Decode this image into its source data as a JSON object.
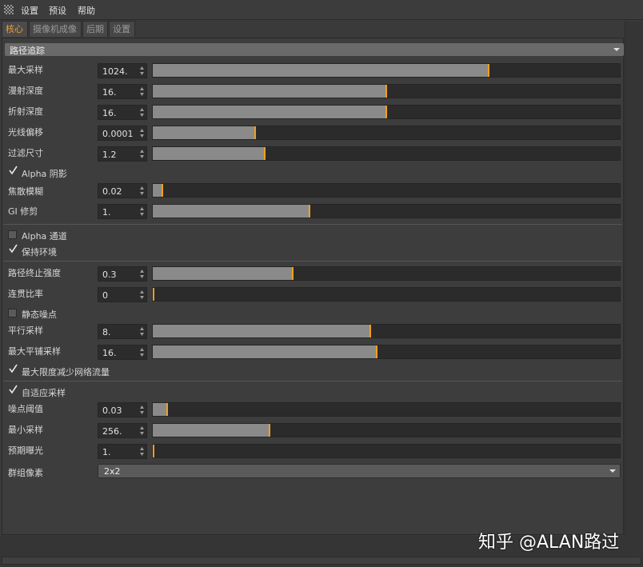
{
  "menubar": {
    "items": [
      "设置",
      "预设",
      "帮助"
    ]
  },
  "tabs": [
    "核心",
    "摄像机成像",
    "后期",
    "设置"
  ],
  "section": {
    "label": "路径追踪"
  },
  "params": {
    "max_samples": {
      "label": "最大采样",
      "value": "1024.",
      "level": 0.72
    },
    "diffuse_depth": {
      "label": "漫射深度",
      "value": "16.",
      "level": 0.5
    },
    "refraction_depth": {
      "label": "折射深度",
      "value": "16.",
      "level": 0.5
    },
    "ray_offset": {
      "label": "光线偏移",
      "value": "0.0001",
      "level": 0.22
    },
    "filter_size": {
      "label": "过滤尺寸",
      "value": "1.2",
      "level": 0.24
    },
    "alpha_shadow": {
      "label": "Alpha 阴影",
      "checked": true
    },
    "caustic_blur": {
      "label": "焦散模糊",
      "value": "0.02",
      "level": 0.02
    },
    "gi_clamp": {
      "label": "GI 修剪",
      "value": "1.",
      "level": 0.335
    },
    "alpha_channel": {
      "label": "Alpha 通道",
      "checked": false
    },
    "keep_environment": {
      "label": "保持环境",
      "checked": true
    },
    "path_termination": {
      "label": "路径终止强度",
      "value": "0.3",
      "level": 0.3
    },
    "coherent_ratio": {
      "label": "连贯比率",
      "value": "0",
      "level": 0.0
    },
    "static_noise": {
      "label": "静态噪点",
      "checked": false
    },
    "parallel_samples": {
      "label": "平行采样",
      "value": "8.",
      "level": 0.465
    },
    "max_tile_samples": {
      "label": "最大平铺采样",
      "value": "16.",
      "level": 0.48
    },
    "minimize_net_traffic": {
      "label": "最大限度减少网络流量",
      "checked": true
    },
    "adaptive_sampling": {
      "label": "自适应采样",
      "checked": true
    },
    "noise_threshold": {
      "label": "噪点阈值",
      "value": "0.03",
      "level": 0.03
    },
    "min_samples": {
      "label": "最小采样",
      "value": "256.",
      "level": 0.25
    },
    "expected_exposure": {
      "label": "预期曝光",
      "value": "1.",
      "level": 0.0
    },
    "group_pixels": {
      "label": "群组像素",
      "value": "2x2"
    }
  },
  "watermark": "知乎 @ALAN路过",
  "colors": {
    "accent": "#f0a020",
    "tab_active": "#f0a030"
  }
}
